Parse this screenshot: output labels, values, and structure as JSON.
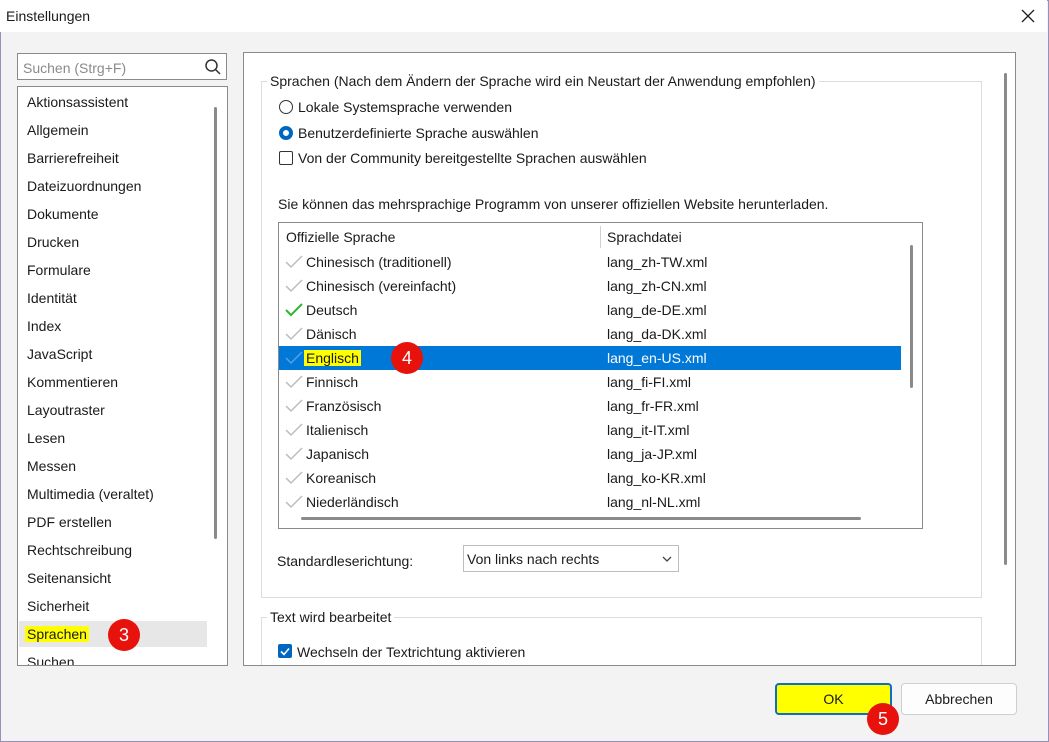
{
  "window": {
    "title": "Einstellungen"
  },
  "search": {
    "placeholder": "Suchen (Strg+F)"
  },
  "categories": [
    "Aktionsassistent",
    "Allgemein",
    "Barrierefreiheit",
    "Dateizuordnungen",
    "Dokumente",
    "Drucken",
    "Formulare",
    "Identität",
    "Index",
    "JavaScript",
    "Kommentieren",
    "Layoutraster",
    "Lesen",
    "Messen",
    "Multimedia (veraltet)",
    "PDF erstellen",
    "Rechtschreibung",
    "Seitenansicht",
    "Sicherheit",
    "Sprachen",
    "Suchen"
  ],
  "selected_category": "Sprachen",
  "languages_group": {
    "title": "Sprachen (Nach dem Ändern der Sprache wird ein Neustart der Anwendung empfohlen)",
    "opt_system": "Lokale Systemsprache verwenden",
    "opt_custom": "Benutzerdefinierte Sprache auswählen",
    "opt_community": "Von der Community bereitgestellte Sprachen auswählen",
    "download_note": "Sie können das mehrsprachige Programm von unserer offiziellen Website herunterladen.",
    "table": {
      "col_language": "Offizielle Sprache",
      "col_file": "Sprachdatei",
      "rows": [
        {
          "name": "Chinesisch (traditionell)",
          "file": "lang_zh-TW.xml"
        },
        {
          "name": "Chinesisch (vereinfacht)",
          "file": "lang_zh-CN.xml"
        },
        {
          "name": "Deutsch",
          "file": "lang_de-DE.xml"
        },
        {
          "name": "Dänisch",
          "file": "lang_da-DK.xml"
        },
        {
          "name": "Englisch",
          "file": "lang_en-US.xml"
        },
        {
          "name": "Finnisch",
          "file": "lang_fi-FI.xml"
        },
        {
          "name": "Französisch",
          "file": "lang_fr-FR.xml"
        },
        {
          "name": "Italienisch",
          "file": "lang_it-IT.xml"
        },
        {
          "name": "Japanisch",
          "file": "lang_ja-JP.xml"
        },
        {
          "name": "Koreanisch",
          "file": "lang_ko-KR.xml"
        },
        {
          "name": "Niederländisch",
          "file": "lang_nl-NL.xml"
        }
      ]
    },
    "direction_label": "Standardleserichtung:",
    "direction_value": "Von links nach rechts"
  },
  "text_group": {
    "title": "Text wird bearbeitet",
    "opt_direction_switch": "Wechseln der Textrichtung aktivieren"
  },
  "buttons": {
    "ok": "OK",
    "cancel": "Abbrechen"
  },
  "markers": {
    "m3": "3",
    "m4": "4",
    "m5": "5"
  },
  "colors": {
    "accent": "#0067c0",
    "selection": "#0078d7",
    "highlight": "#ffff00",
    "marker": "#e8120c",
    "installed_check": "#2fb52f"
  }
}
